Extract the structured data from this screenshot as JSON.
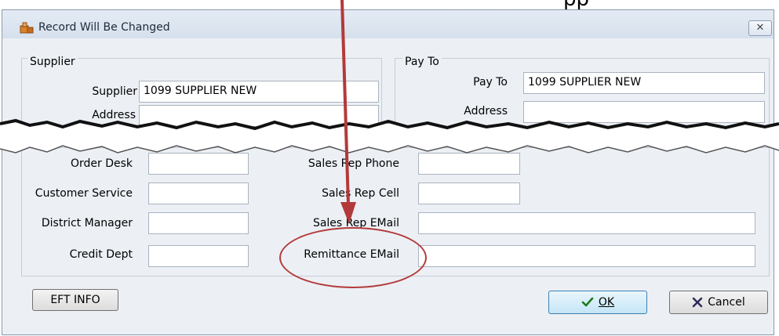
{
  "caption_fragment": "pp",
  "window": {
    "title": "Record Will Be Changed",
    "close_label": "✕"
  },
  "supplier_group": {
    "legend": "Supplier",
    "supplier_label": "Supplier",
    "supplier_value": "1099 SUPPLIER NEW",
    "address_label": "Address",
    "address_value": ""
  },
  "payto_group": {
    "legend": "Pay To",
    "payto_label": "Pay To",
    "payto_value": "1099 SUPPLIER NEW",
    "address_label": "Address",
    "address_value": ""
  },
  "contacts": {
    "left": [
      {
        "label": "Order Desk",
        "value": ""
      },
      {
        "label": "Customer Service",
        "value": ""
      },
      {
        "label": "District Manager",
        "value": ""
      },
      {
        "label": "Credit Dept",
        "value": ""
      }
    ],
    "right": [
      {
        "label": "Sales Rep Phone",
        "value": ""
      },
      {
        "label": "Sales Rep Cell",
        "value": ""
      },
      {
        "label": "Sales Rep EMail",
        "value": ""
      },
      {
        "label": "Remittance EMail",
        "value": ""
      }
    ]
  },
  "buttons": {
    "eft_info": "EFT INFO",
    "ok": "OK",
    "cancel": "Cancel"
  },
  "annotation": {
    "arrow_color": "#b33a3a",
    "circle_color": "#b33a3a"
  }
}
